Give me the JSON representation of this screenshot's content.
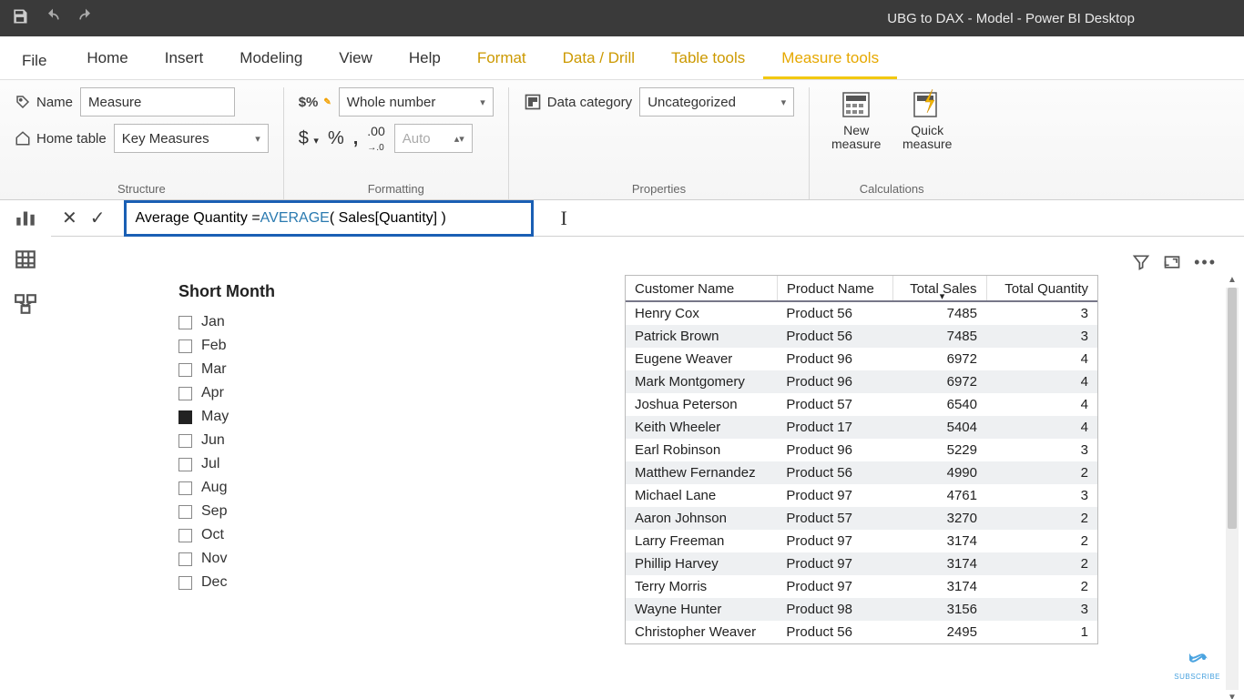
{
  "app_title": "UBG to DAX - Model - Power BI Desktop",
  "tabs": {
    "file": "File",
    "items": [
      "Home",
      "Insert",
      "Modeling",
      "View",
      "Help"
    ],
    "contextual": [
      "Format",
      "Data / Drill",
      "Table tools",
      "Measure tools"
    ],
    "active": "Measure tools"
  },
  "ribbon": {
    "structure": {
      "name_label": "Name",
      "name_value": "Measure",
      "home_table_label": "Home table",
      "home_table_value": "Key Measures",
      "group_label": "Structure"
    },
    "formatting": {
      "format_value": "Whole number",
      "auto_placeholder": "Auto",
      "group_label": "Formatting"
    },
    "properties": {
      "data_category_label": "Data category",
      "data_category_value": "Uncategorized",
      "group_label": "Properties"
    },
    "calculations": {
      "new_measure": "New measure",
      "quick_measure": "Quick measure",
      "group_label": "Calculations"
    }
  },
  "formula": {
    "text_pre": "Average Quantity = ",
    "fn": "AVERAGE",
    "text_post": "( Sales[Quantity] )"
  },
  "slicer": {
    "title": "Short Month",
    "options": [
      {
        "label": "Jan",
        "checked": false
      },
      {
        "label": "Feb",
        "checked": false
      },
      {
        "label": "Mar",
        "checked": false
      },
      {
        "label": "Apr",
        "checked": false
      },
      {
        "label": "May",
        "checked": true
      },
      {
        "label": "Jun",
        "checked": false
      },
      {
        "label": "Jul",
        "checked": false
      },
      {
        "label": "Aug",
        "checked": false
      },
      {
        "label": "Sep",
        "checked": false
      },
      {
        "label": "Oct",
        "checked": false
      },
      {
        "label": "Nov",
        "checked": false
      },
      {
        "label": "Dec",
        "checked": false
      }
    ]
  },
  "table": {
    "columns": [
      "Customer Name",
      "Product Name",
      "Total Sales",
      "Total Quantity"
    ],
    "sorted_col": 2,
    "rows": [
      [
        "Henry Cox",
        "Product 56",
        "7485",
        "3"
      ],
      [
        "Patrick Brown",
        "Product 56",
        "7485",
        "3"
      ],
      [
        "Eugene Weaver",
        "Product 96",
        "6972",
        "4"
      ],
      [
        "Mark Montgomery",
        "Product 96",
        "6972",
        "4"
      ],
      [
        "Joshua Peterson",
        "Product 57",
        "6540",
        "4"
      ],
      [
        "Keith Wheeler",
        "Product 17",
        "5404",
        "4"
      ],
      [
        "Earl Robinson",
        "Product 96",
        "5229",
        "3"
      ],
      [
        "Matthew Fernandez",
        "Product 56",
        "4990",
        "2"
      ],
      [
        "Michael Lane",
        "Product 97",
        "4761",
        "3"
      ],
      [
        "Aaron Johnson",
        "Product 57",
        "3270",
        "2"
      ],
      [
        "Larry Freeman",
        "Product 97",
        "3174",
        "2"
      ],
      [
        "Phillip Harvey",
        "Product 97",
        "3174",
        "2"
      ],
      [
        "Terry Morris",
        "Product 97",
        "3174",
        "2"
      ],
      [
        "Wayne Hunter",
        "Product 98",
        "3156",
        "3"
      ],
      [
        "Christopher Weaver",
        "Product 56",
        "2495",
        "1"
      ]
    ]
  },
  "subscribe_label": "SUBSCRIBE"
}
